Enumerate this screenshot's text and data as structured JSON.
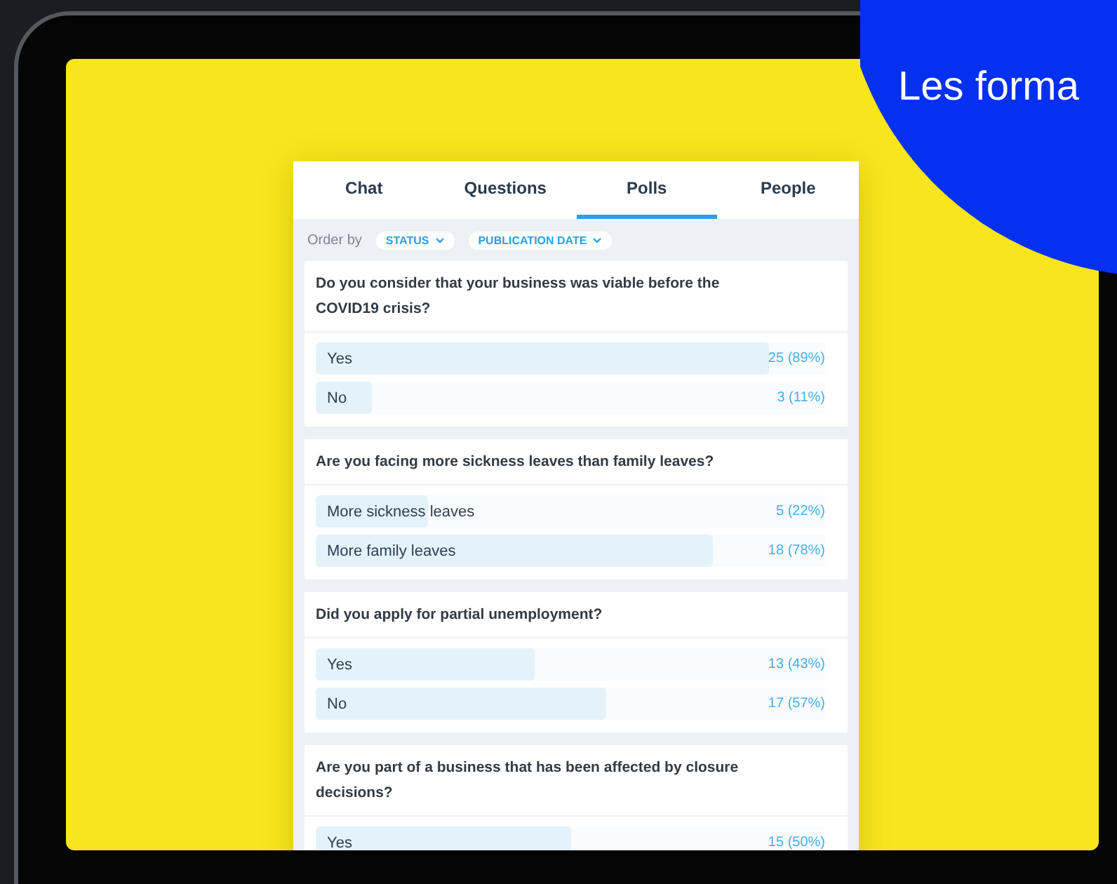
{
  "banner": {
    "text": "Les forma"
  },
  "tabs": [
    {
      "label": "Chat",
      "selected": false
    },
    {
      "label": "Questions",
      "selected": false
    },
    {
      "label": "Polls",
      "selected": true
    },
    {
      "label": "People",
      "selected": false
    }
  ],
  "order_by": {
    "label": "Order by",
    "options": [
      "STATUS",
      "PUBLICATION DATE"
    ]
  },
  "polls": [
    {
      "question": "Do you consider that your business was viable before the COVID19 crisis?",
      "answers": [
        {
          "label": "Yes",
          "result": "25 (89%)",
          "level": 0.89
        },
        {
          "label": "No",
          "result": "3 (11%)",
          "level": 0.11
        }
      ]
    },
    {
      "question": "Are you facing more sickness leaves than family leaves?",
      "answers": [
        {
          "label": "More sickness leaves",
          "result": "5 (22%)",
          "level": 0.22
        },
        {
          "label": "More family leaves",
          "result": "18 (78%)",
          "level": 0.78
        }
      ]
    },
    {
      "question": "Did you apply for partial unemployment?",
      "answers": [
        {
          "label": "Yes",
          "result": "13 (43%)",
          "level": 0.43
        },
        {
          "label": "No",
          "result": "17 (57%)",
          "level": 0.57
        }
      ]
    },
    {
      "question": "Are you part of a business that has been affected by closure decisions?",
      "answers": [
        {
          "label": "Yes",
          "result": "15 (50%)",
          "level": 0.5
        }
      ]
    }
  ]
}
